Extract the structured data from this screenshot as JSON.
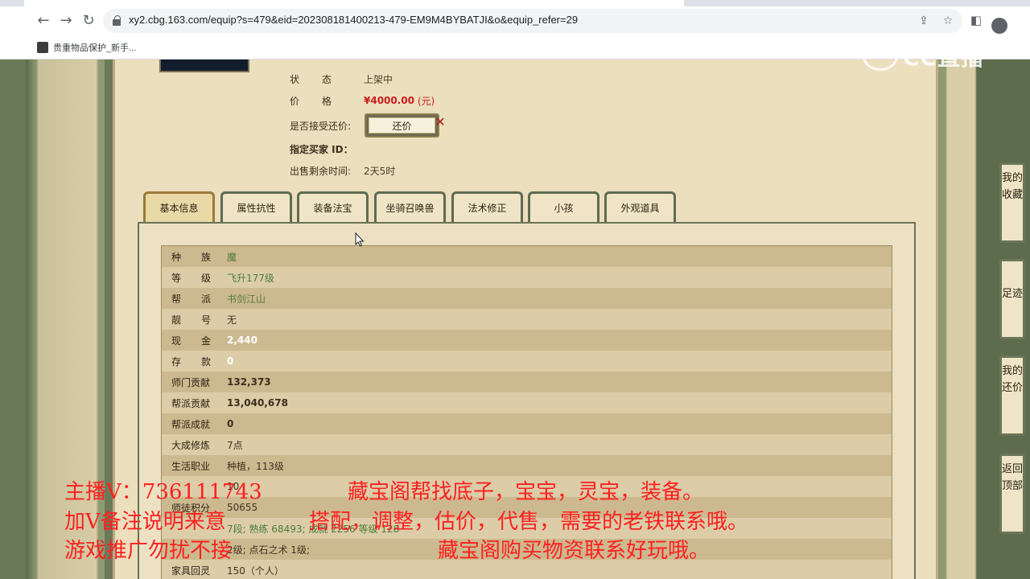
{
  "browser": {
    "url": "xy2.cbg.163.com/equip?s=479&eid=202308181400213-479-EM9M4BYBATJI&o&equip_refer=29",
    "bookmark": "贵重物品保护_新手..."
  },
  "watermark": {
    "text": "CC直播"
  },
  "listing": {
    "status_key": "状态",
    "status_value": "上架中",
    "price_key": "价格",
    "price_value": "¥4000.00",
    "price_unit": "(元)",
    "bargain_key": "是否接受还价:",
    "bargain_button": "还价",
    "buyer_key": "指定买家 ID：",
    "remaining_key": "出售剩余时间:",
    "remaining_value": "2天5时"
  },
  "tabs": [
    "基本信息",
    "属性抗性",
    "装备法宝",
    "坐骑召唤兽",
    "法术修正",
    "小孩",
    "外观道具"
  ],
  "table": [
    {
      "key": "种族",
      "value": "魔"
    },
    {
      "key": "等级",
      "value": "飞升177级"
    },
    {
      "key": "帮派",
      "value": "书剑江山"
    },
    {
      "key": "靓号",
      "value": "无"
    },
    {
      "key": "现金",
      "value": "2,440"
    },
    {
      "key": "存款",
      "value": "0"
    },
    {
      "key": "师门贡献",
      "value": "132,373"
    },
    {
      "key": "帮派贡献",
      "value": "13,040,678"
    },
    {
      "key": "帮派成就",
      "value": "0"
    },
    {
      "key": "大成修炼",
      "value": "7点"
    },
    {
      "key": "生活职业",
      "value": "种植，113级"
    },
    {
      "key": "",
      "value": "10"
    },
    {
      "key": "师徒积分",
      "value": "50655"
    },
    {
      "key": "",
      "value": "7段; 熟练 68493; 成就 2256 等级 128"
    },
    {
      "key": "",
      "value": "2级; 点石之术 1级;"
    },
    {
      "key": "家具回灵",
      "value": "150（个人）"
    }
  ],
  "side_nav": [
    {
      "label": "我的收藏"
    },
    {
      "label": "足迹"
    },
    {
      "label": "我的还价"
    },
    {
      "label": "返回顶部"
    }
  ],
  "overlay": {
    "line1a": "主播V：736111743",
    "line1b": "藏宝阁帮找底子，宝宝，灵宝，装备。",
    "line2a": "加V备注说明来意",
    "line2b": "搭配，调整，估价，代售，需要的老铁联系哦。",
    "line3a": "游戏推广勿扰不接",
    "line3b": "藏宝阁购买物资联系好玩哦。"
  }
}
